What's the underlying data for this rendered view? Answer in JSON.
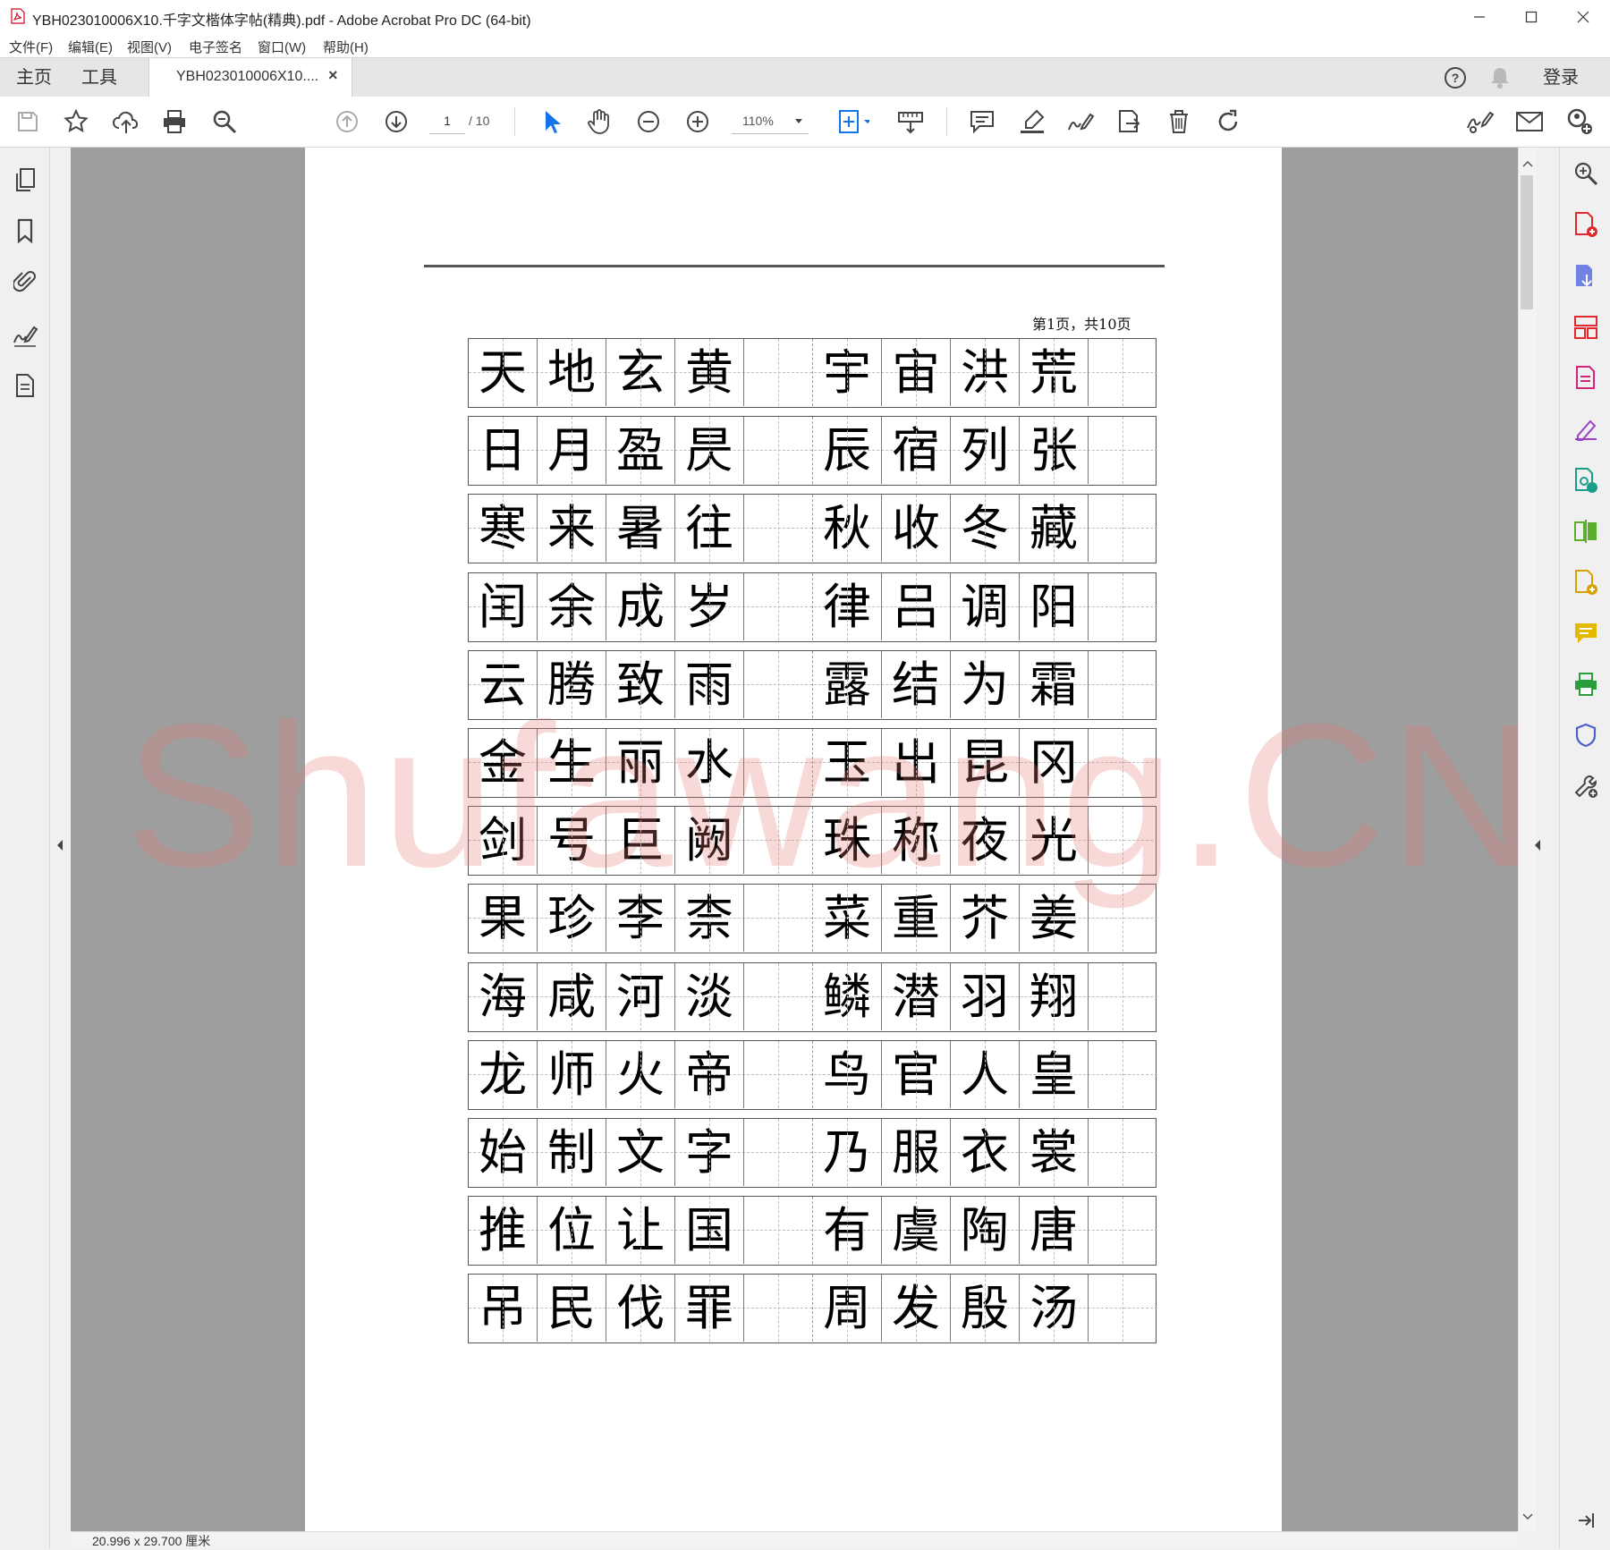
{
  "window": {
    "title": "YBH023010006X10.千字文楷体字帖(精典).pdf - Adobe Acrobat Pro DC (64-bit)"
  },
  "menu": [
    "文件(F)",
    "编辑(E)",
    "视图(V)",
    "电子签名",
    "窗口(W)",
    "帮助(H)"
  ],
  "tabs": {
    "home": "主页",
    "tools": "工具",
    "document": "YBH023010006X10....",
    "close": "×",
    "signin": "登录"
  },
  "toolbar": {
    "current_page": "1",
    "total_pages": "/ 10",
    "zoom": "110%"
  },
  "document": {
    "page_label": "第1页，共10页",
    "rows": [
      [
        [
          "天",
          "地",
          "玄",
          "黄"
        ],
        [
          "宇",
          "宙",
          "洪",
          "荒"
        ]
      ],
      [
        [
          "日",
          "月",
          "盈",
          "昃"
        ],
        [
          "辰",
          "宿",
          "列",
          "张"
        ]
      ],
      [
        [
          "寒",
          "来",
          "暑",
          "往"
        ],
        [
          "秋",
          "收",
          "冬",
          "藏"
        ]
      ],
      [
        [
          "闰",
          "余",
          "成",
          "岁"
        ],
        [
          "律",
          "吕",
          "调",
          "阳"
        ]
      ],
      [
        [
          "云",
          "腾",
          "致",
          "雨"
        ],
        [
          "露",
          "结",
          "为",
          "霜"
        ]
      ],
      [
        [
          "金",
          "生",
          "丽",
          "水"
        ],
        [
          "玉",
          "出",
          "昆",
          "冈"
        ]
      ],
      [
        [
          "剑",
          "号",
          "巨",
          "阙"
        ],
        [
          "珠",
          "称",
          "夜",
          "光"
        ]
      ],
      [
        [
          "果",
          "珍",
          "李",
          "柰"
        ],
        [
          "菜",
          "重",
          "芥",
          "姜"
        ]
      ],
      [
        [
          "海",
          "咸",
          "河",
          "淡"
        ],
        [
          "鳞",
          "潜",
          "羽",
          "翔"
        ]
      ],
      [
        [
          "龙",
          "师",
          "火",
          "帝"
        ],
        [
          "鸟",
          "官",
          "人",
          "皇"
        ]
      ],
      [
        [
          "始",
          "制",
          "文",
          "字"
        ],
        [
          "乃",
          "服",
          "衣",
          "裳"
        ]
      ],
      [
        [
          "推",
          "位",
          "让",
          "国"
        ],
        [
          "有",
          "虞",
          "陶",
          "唐"
        ]
      ],
      [
        [
          "吊",
          "民",
          "伐",
          "罪"
        ],
        [
          "周",
          "发",
          "殷",
          "汤"
        ]
      ]
    ],
    "watermark": "Shufawang.CN"
  },
  "status": {
    "page_size": "20.996 x 29.700 厘米"
  },
  "colors": {
    "acrobat_red": "#d0021b",
    "select_blue": "#1473e6",
    "watermark": "#e1786e"
  }
}
